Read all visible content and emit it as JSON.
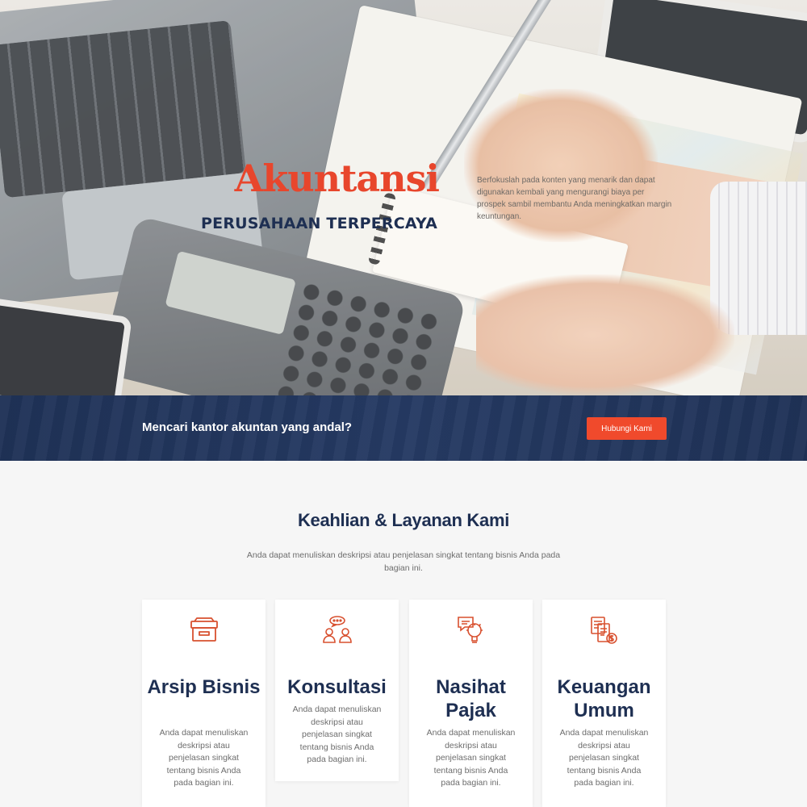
{
  "hero": {
    "title": "Akuntansi",
    "subtitle": "PERUSAHAAN TERPERCAYA",
    "description": "Berfokuslah pada konten yang menarik dan dapat digunakan kembali yang mengurangi biaya per prospek sambil membantu Anda meningkatkan margin keuntungan."
  },
  "cta": {
    "text": "Mencari kantor akuntan yang andal?",
    "button_label": "Hubungi Kami"
  },
  "services": {
    "title": "Keahlian & Layanan Kami",
    "description": "Anda dapat menuliskan deskripsi atau penjelasan singkat tentang bisnis Anda pada bagian ini.",
    "items": [
      {
        "icon": "archive-box-icon",
        "title": "Arsip Bisnis",
        "text": "Anda dapat menuliskan deskripsi atau penjelasan singkat tentang bisnis Anda pada bagian ini."
      },
      {
        "icon": "consultation-icon",
        "title": "Konsultasi",
        "text": "Anda dapat menuliskan deskripsi atau penjelasan singkat tentang bisnis Anda pada bagian ini."
      },
      {
        "icon": "lightbulb-chat-icon",
        "title": "Nasihat Pajak",
        "text": "Anda dapat menuliskan deskripsi atau penjelasan singkat tentang bisnis Anda pada bagian ini."
      },
      {
        "icon": "finance-document-icon",
        "title": "Keuangan Umum",
        "text": "Anda dapat menuliskan deskripsi atau penjelasan singkat tentang bisnis Anda pada bagian ini."
      }
    ]
  },
  "colors": {
    "accent": "#e8462c",
    "navy": "#1e2f52",
    "button": "#f04a2c"
  }
}
